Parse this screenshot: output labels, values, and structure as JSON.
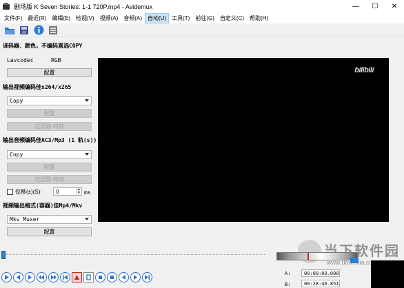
{
  "window": {
    "title": "剧场版 K Seven Stories: 1-1 720P.mp4 - Avidemux",
    "controls": [
      "—",
      "☐",
      "✕"
    ]
  },
  "menu": [
    "文件(F)",
    "最近(R)",
    "编辑(E)",
    "检视(V)",
    "视频(A)",
    "音频(A)",
    "自动(U)",
    "工具(T)",
    "前往(G)",
    "自定义(C)",
    "帮助(H)"
  ],
  "active_menu_index": 6,
  "toolbar": {
    "icons": [
      "open-folder-icon",
      "save-disk-icon",
      "info-icon",
      "properties-icon"
    ]
  },
  "video_decoder": {
    "title": "译码器．颜色，不编码直选COPY",
    "decoder_label": "Lavcodec",
    "format_label": "RGB",
    "configure_label": "配置"
  },
  "video_output": {
    "title": "输出视频编码佳x264/x265",
    "selected": "Copy",
    "configure_label": "配置",
    "filters_label": "过滤器-特效"
  },
  "audio_output": {
    "title": "输出音频编码佳AC3/Mp3 (1 轨(s))",
    "selected": "Copy",
    "configure_label": "配置",
    "filters_label": "过滤器-特效",
    "shift_label": "位移(±)(S):",
    "shift_value": "0",
    "shift_unit": "ms"
  },
  "output_format": {
    "title": "视频输出格式(容器)佳Mp4/Mkv",
    "selected": "Mkv Muxer",
    "configure_label": "配置"
  },
  "player": {
    "watermark": "bilibili",
    "seek_position": 0.0,
    "time_a_label": "A:",
    "time_a": "00:00:00.000",
    "time_b_label": "B:",
    "time_b": "00:28:46.851",
    "volume_level": 0.38
  },
  "site_overlay": {
    "big_text": "当下软件园",
    "small_text": "www.downxia.com"
  },
  "colors": {
    "accent": "#2a7fd4",
    "active_menu_bg": "#cce4f7",
    "video_bg": "#000000"
  }
}
